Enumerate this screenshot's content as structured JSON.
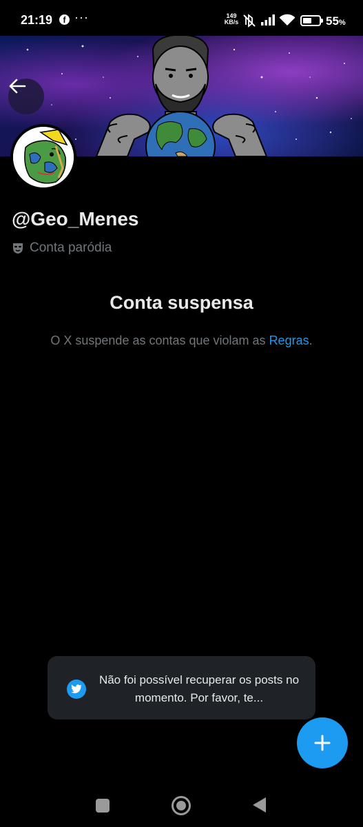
{
  "status_bar": {
    "time": "21:19",
    "more": "···",
    "net_speed_value": "149",
    "net_speed_unit": "KB/s",
    "battery_percent": "55",
    "battery_unit": "%"
  },
  "profile": {
    "handle": "@Geo_Menes",
    "label": "Conta paródia"
  },
  "suspended": {
    "title": "Conta suspensa",
    "description": "O X suspende as contas que violam as ",
    "rules_link": "Regras",
    "period": "."
  },
  "toast": {
    "message": "Não foi possível recuperar os posts no momento. Por favor, te..."
  },
  "colors": {
    "accent": "#1d9bf0",
    "background": "#000000",
    "muted_text": "#71767b",
    "toast_bg": "#1f2327"
  },
  "icons": {
    "back": "arrow-left-icon",
    "parody": "theater-mask-icon",
    "toast": "twitter-bird-icon",
    "compose": "plus-icon"
  }
}
